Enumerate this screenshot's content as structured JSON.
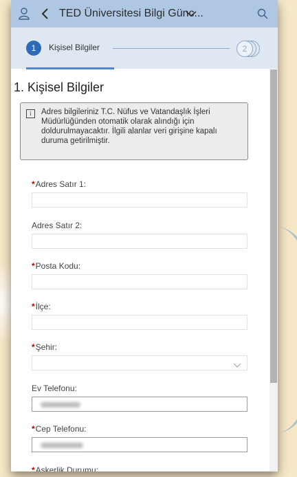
{
  "app": {
    "title": "TED Üniversitesi Bilgi Günc...",
    "icons": [
      "person-icon",
      "back-icon",
      "chevron-down-icon",
      "search-icon"
    ]
  },
  "stepper": {
    "steps": [
      {
        "number": "1",
        "label": "Kişisel Bilgiler",
        "active": true
      },
      {
        "number": "2",
        "label": "",
        "active": false
      }
    ]
  },
  "section": {
    "title": "1. Kişisel Bilgiler",
    "info": "Adres bilgileriniz T.C. Nüfus ve Vatandaşlık İşleri Müdürlüğünden otomatik olarak alındığı için doldurulmayacaktır. İlgili alanlar veri girişine kapalı duruma getirilmiştir."
  },
  "fields": [
    {
      "label": "Adres Satır 1:",
      "required": true,
      "value": ""
    },
    {
      "label": "Adres Satır 2:",
      "required": false,
      "value": ""
    },
    {
      "label": "Posta Kodu:",
      "required": true,
      "value": ""
    },
    {
      "label": "İlçe:",
      "required": true,
      "value": ""
    },
    {
      "label": "Şehir:",
      "required": true,
      "value": "",
      "type": "select"
    },
    {
      "label": "Ev Telefonu:",
      "required": false,
      "value": "(redacted)"
    },
    {
      "label": "Cep Telefonu:",
      "required": true,
      "value": "(redacted)"
    },
    {
      "label": "Askerlik Durumu:",
      "required": true,
      "value": ""
    }
  ],
  "colors": {
    "topbar": "#afc7e3",
    "stepper": "#dfe8f2",
    "accent": "#2d6ab8",
    "required": "#b30000"
  }
}
